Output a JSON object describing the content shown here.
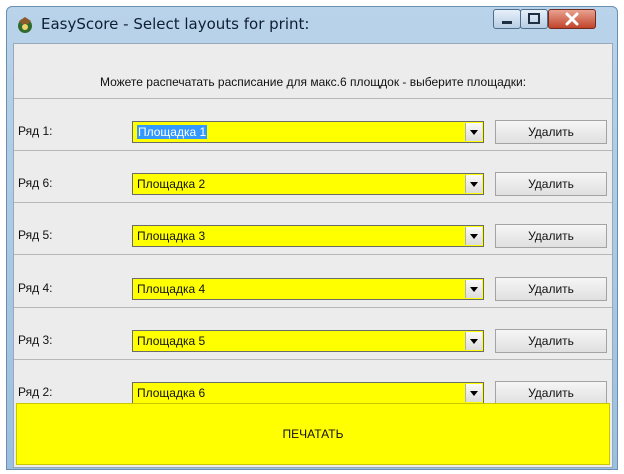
{
  "window": {
    "title": "EasyScore - Select layouts for print:",
    "icon": "easyscore-app-icon",
    "controls": [
      "minimize-icon",
      "maximize-icon",
      "close-icon"
    ]
  },
  "hint": "Можете распечатать расписание для макс.6 площдок - выберите площадки:",
  "rows": [
    {
      "label": "Ряд 1:",
      "value": "Площадка 1",
      "selected": true,
      "delete_label": "Удалить"
    },
    {
      "label": "Ряд 6:",
      "value": "Площадка 2",
      "selected": false,
      "delete_label": "Удалить"
    },
    {
      "label": "Ряд 5:",
      "value": "Площадка 3",
      "selected": false,
      "delete_label": "Удалить"
    },
    {
      "label": "Ряд 4:",
      "value": "Площадка 4",
      "selected": false,
      "delete_label": "Удалить"
    },
    {
      "label": "Ряд 3:",
      "value": "Площадка 5",
      "selected": false,
      "delete_label": "Удалить"
    },
    {
      "label": "Ряд 2:",
      "value": "Площадка 6",
      "selected": false,
      "delete_label": "Удалить"
    }
  ],
  "print_label": "ПЕЧАТАТЬ",
  "colors": {
    "combo_background": "#ffff00",
    "print_button_background": "#ffff00",
    "selection": "#3399ff",
    "close_button": "#c1442a"
  }
}
